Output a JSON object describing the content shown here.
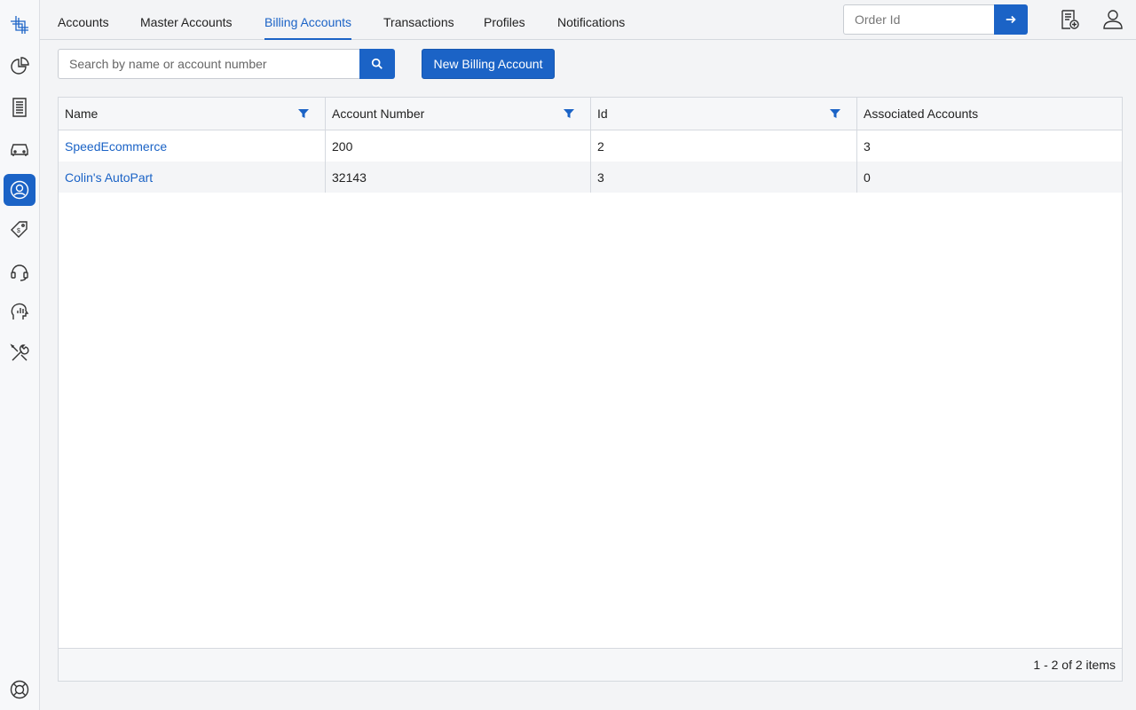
{
  "sidebar": {
    "items": [
      {
        "name": "logo-icon"
      },
      {
        "name": "dashboard-pie-icon"
      },
      {
        "name": "receipt-icon"
      },
      {
        "name": "car-icon"
      },
      {
        "name": "user-circle-icon",
        "active": true
      },
      {
        "name": "price-tag-icon"
      },
      {
        "name": "headset-support-icon"
      },
      {
        "name": "analytics-head-icon"
      },
      {
        "name": "tools-icon"
      },
      {
        "name": "help-lifebuoy-icon"
      }
    ]
  },
  "nav": {
    "tabs": [
      {
        "label": "Accounts"
      },
      {
        "label": "Master Accounts"
      },
      {
        "label": "Billing Accounts",
        "active": true
      },
      {
        "label": "Transactions"
      },
      {
        "label": "Profiles"
      },
      {
        "label": "Notifications"
      }
    ],
    "order_placeholder": "Order Id"
  },
  "toolbar": {
    "search_placeholder": "Search by name or account number",
    "new_button_label": "New Billing Account"
  },
  "grid": {
    "columns": [
      "Name",
      "Account Number",
      "Id",
      "Associated Accounts"
    ],
    "rows": [
      [
        "SpeedEcommerce",
        "200",
        "2",
        "3"
      ],
      [
        "Colin's AutoPart",
        "32143",
        "3",
        "0"
      ]
    ],
    "pager_text": "1 - 2 of 2 items"
  },
  "colors": {
    "accent": "#1b63c6"
  }
}
